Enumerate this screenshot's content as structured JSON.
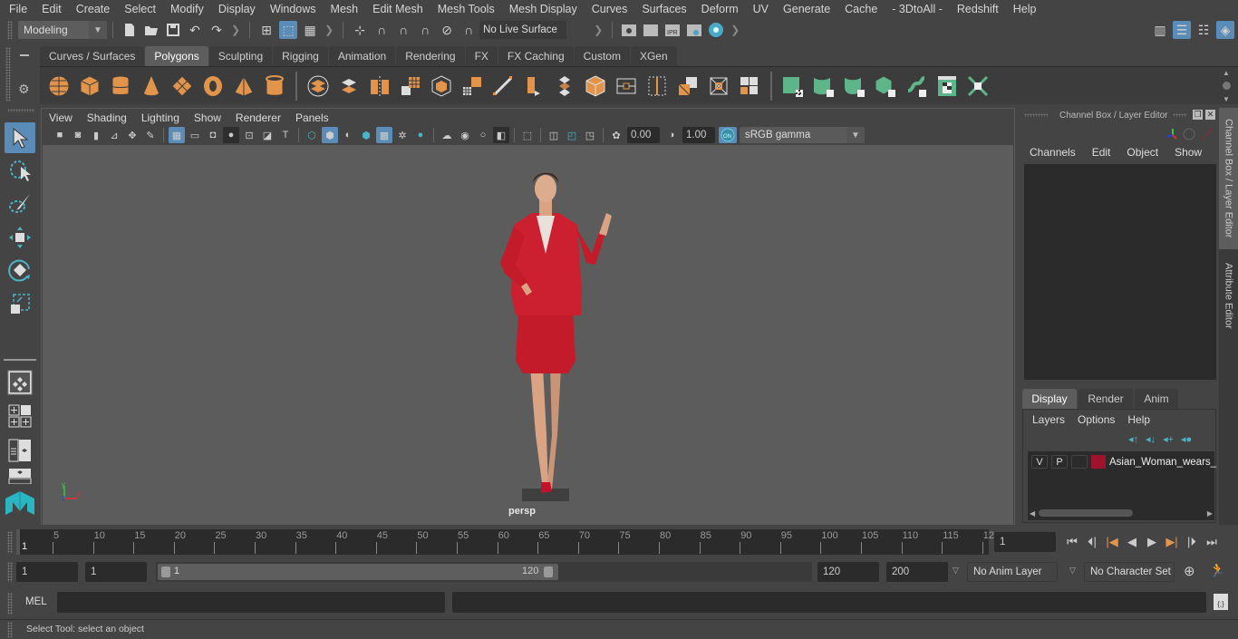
{
  "menubar": {
    "items": [
      "File",
      "Edit",
      "Create",
      "Select",
      "Modify",
      "Display",
      "Windows",
      "Mesh",
      "Edit Mesh",
      "Mesh Tools",
      "Mesh Display",
      "Curves",
      "Surfaces",
      "Deform",
      "UV",
      "Generate",
      "Cache",
      "- 3DtoAll -",
      "Redshift",
      "Help"
    ]
  },
  "statusline": {
    "menuset": "Modeling",
    "live_surface": "No Live Surface"
  },
  "shelf": {
    "tabs": [
      "Curves / Surfaces",
      "Polygons",
      "Sculpting",
      "Rigging",
      "Animation",
      "Rendering",
      "FX",
      "FX Caching",
      "Custom",
      "XGen"
    ],
    "active_tab": "Polygons",
    "colors": {
      "orange": "#e3944b",
      "green": "#5fb58a",
      "select_blue": "#5a8cb7"
    }
  },
  "viewport": {
    "menu": [
      "View",
      "Shading",
      "Lighting",
      "Show",
      "Renderer",
      "Panels"
    ],
    "exposure": "0.00",
    "gamma": "1.00",
    "color_space": "sRGB gamma",
    "camera_label": "persp",
    "axis": {
      "x": "x",
      "y": "y",
      "z": "z"
    }
  },
  "channel_box": {
    "title": "Channel Box / Layer Editor",
    "menu": [
      "Channels",
      "Edit",
      "Object",
      "Show"
    ]
  },
  "layer_editor": {
    "tabs": [
      "Display",
      "Render",
      "Anim"
    ],
    "active_tab": "Display",
    "menu": [
      "Layers",
      "Options",
      "Help"
    ],
    "layers": [
      {
        "v": "V",
        "p": "P",
        "color": "#a0132c",
        "name": "Asian_Woman_wears_"
      }
    ]
  },
  "side_tabs": [
    "Channel Box / Layer Editor",
    "Attribute Editor"
  ],
  "timeline": {
    "ticks": [
      5,
      10,
      15,
      20,
      25,
      30,
      35,
      40,
      45,
      50,
      55,
      60,
      65,
      70,
      75,
      80,
      85,
      90,
      95,
      100,
      105,
      110,
      115,
      "12"
    ],
    "current_frame_marker": "1",
    "current_frame": "1"
  },
  "range": {
    "start": "1",
    "anim_start": "1",
    "range_start_label": "1",
    "range_end_label": "120",
    "playback_end": "120",
    "anim_end": "200",
    "anim_layer": "No Anim Layer",
    "character_set": "No Character Set"
  },
  "command_line": {
    "lang": "MEL",
    "input": "",
    "result": ""
  },
  "help_line": "Select Tool: select an object"
}
